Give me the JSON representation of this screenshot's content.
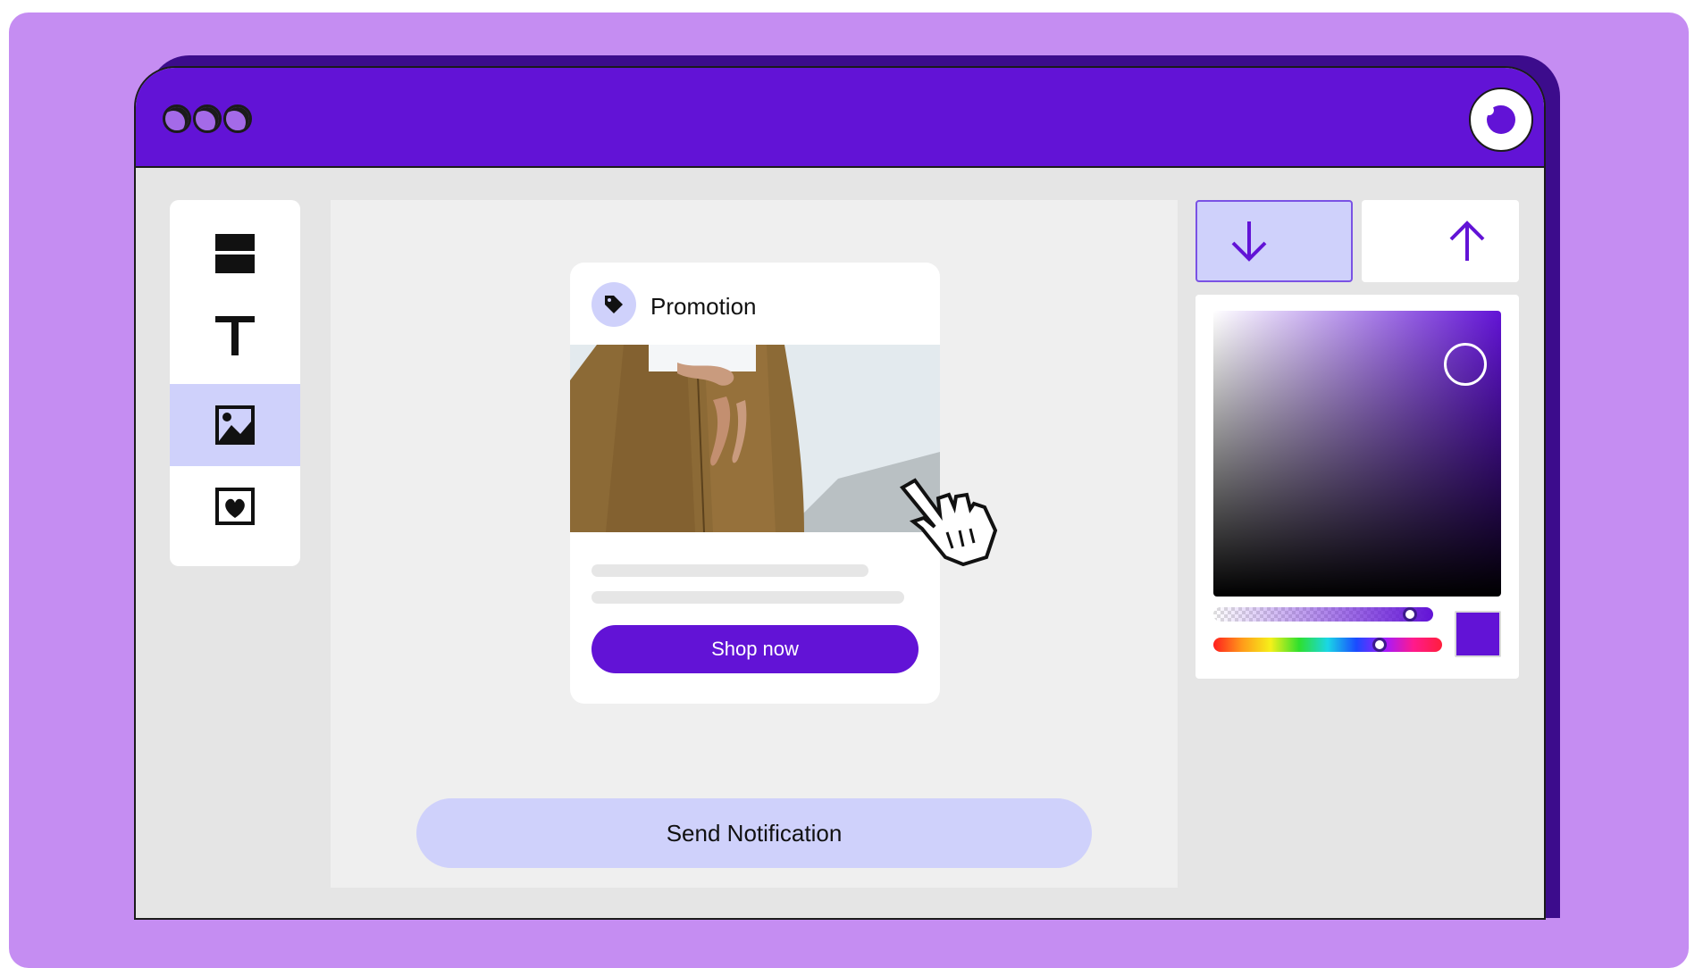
{
  "window": {
    "title_dots": [
      "dot-1",
      "dot-2",
      "dot-3"
    ],
    "logo_icon": "brand-logo-icon",
    "accent_color": "#6213d6",
    "background_color": "#c58df2"
  },
  "toolbar": {
    "items": [
      {
        "name": "layout-icon",
        "active": false
      },
      {
        "name": "text-icon",
        "active": false
      },
      {
        "name": "image-icon",
        "active": true
      },
      {
        "name": "heart-frame-icon",
        "active": false
      }
    ]
  },
  "card": {
    "tag_icon": "tag-icon",
    "title": "Promotion",
    "cta_label": "Shop now"
  },
  "canvas": {
    "send_label": "Send Notification"
  },
  "panel": {
    "down_icon": "arrow-down-icon",
    "up_icon": "arrow-up-icon",
    "selected_color": "#6213d6",
    "alpha_level": 0.92,
    "hue_level": 0.74
  }
}
